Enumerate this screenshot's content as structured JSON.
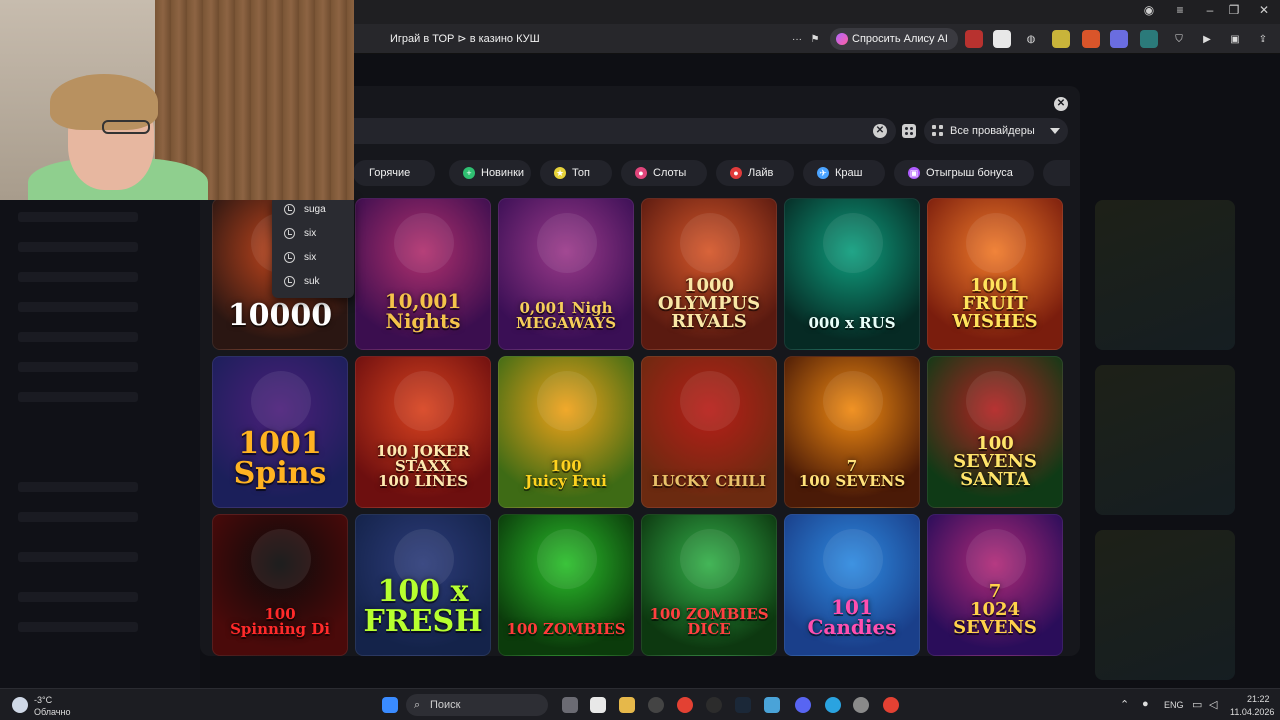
{
  "browser": {
    "tab_title": "Играй в ТОР ⊳ в казино КУШ",
    "alisa_label": "Спросить Алису AI",
    "menu_dots": "···"
  },
  "modal": {
    "search_value": "",
    "providers_label": "Все провайдеры",
    "categories": [
      {
        "label": "Горячие",
        "icon": "fire-icon",
        "color": "#ff7a2f"
      },
      {
        "label": "Новинки",
        "icon": "plus-icon",
        "color": "#2fbf71"
      },
      {
        "label": "Топ",
        "icon": "star-icon",
        "color": "#e6d23a"
      },
      {
        "label": "Слоты",
        "icon": "cherry-icon",
        "color": "#e0457b"
      },
      {
        "label": "Лайв",
        "icon": "live-icon",
        "color": "#e03b3b"
      },
      {
        "label": "Краш",
        "icon": "plane-icon",
        "color": "#4aa3ff"
      },
      {
        "label": "Отыгрыш бонуса",
        "icon": "gift-icon",
        "color": "#b05cff"
      }
    ],
    "suggestions": [
      "suga",
      "six",
      "six",
      "suk"
    ],
    "games": [
      {
        "title": "10000",
        "colors": [
          "#2a1612",
          "#c2461d"
        ],
        "text_color": "#ffffff"
      },
      {
        "title": "10,001\nNights",
        "colors": [
          "#3b0e4f",
          "#b0306e"
        ],
        "text_color": "#f4c34a"
      },
      {
        "title": "0,001 Nigh\nMEGAWAYS",
        "colors": [
          "#3a0f55",
          "#9b3a8a"
        ],
        "text_color": "#f6cf5a"
      },
      {
        "title": "1000\nOLYMPUS\nRIVALS",
        "colors": [
          "#5a1a10",
          "#d6572a"
        ],
        "text_color": "#f9e7a6"
      },
      {
        "title": "000 x RUS",
        "colors": [
          "#062a24",
          "#0f9e7e"
        ],
        "text_color": "#e9fffa"
      },
      {
        "title": "1001\nFRUIT\nWISHES",
        "colors": [
          "#7a1d0d",
          "#f07a2a"
        ],
        "text_color": "#ffe45c"
      },
      {
        "title": "1001\nSpins",
        "colors": [
          "#1b1f5a",
          "#4b1f7a"
        ],
        "text_color": "#ffb321"
      },
      {
        "title": "100 JOKER\nSTAXX\n100 LINES",
        "colors": [
          "#6d0f0f",
          "#d8421f"
        ],
        "text_color": "#ffe9b0"
      },
      {
        "title": "100\nJuicy Frui",
        "colors": [
          "#3e6b15",
          "#f0a21a"
        ],
        "text_color": "#ffd21f"
      },
      {
        "title": "LUCKY CHILI",
        "colors": [
          "#6b2a10",
          "#b71e18"
        ],
        "text_color": "#e9c26a"
      },
      {
        "title": "7\n100 SEVENS",
        "colors": [
          "#4a1a07",
          "#f08a12"
        ],
        "text_color": "#ffe27a"
      },
      {
        "title": "100\nSEVENS\nSANTA",
        "colors": [
          "#0f3a16",
          "#b22222"
        ],
        "text_color": "#ffe46a"
      },
      {
        "title": "100\nSpinning Di",
        "colors": [
          "#4a0a0a",
          "#0b0b0b"
        ],
        "text_color": "#ff2a2a"
      },
      {
        "title": "100 x\nFRESH",
        "colors": [
          "#14234a",
          "#2d3c7a"
        ],
        "text_color": "#b7ff2f"
      },
      {
        "title": "100 ZOMBIES",
        "colors": [
          "#0b3b0b",
          "#2bbf2b"
        ],
        "text_color": "#ff3a3a"
      },
      {
        "title": "100 ZOMBIES\nDICE",
        "colors": [
          "#0d3810",
          "#34b04a"
        ],
        "text_color": "#ff4040"
      },
      {
        "title": "101\nCandies",
        "colors": [
          "#1a3f8a",
          "#2e8ae0"
        ],
        "text_color": "#ff4fb0"
      },
      {
        "title": "7\n1024\nSEVENS",
        "colors": [
          "#2a0d5a",
          "#b02a78"
        ],
        "text_color": "#ffd24a"
      }
    ]
  },
  "taskbar": {
    "weather_temp": "-3°C",
    "weather_text": "Облачно",
    "search_label": "Поиск",
    "lang": "ENG",
    "time": "21:22",
    "date": "11.04.2026"
  }
}
